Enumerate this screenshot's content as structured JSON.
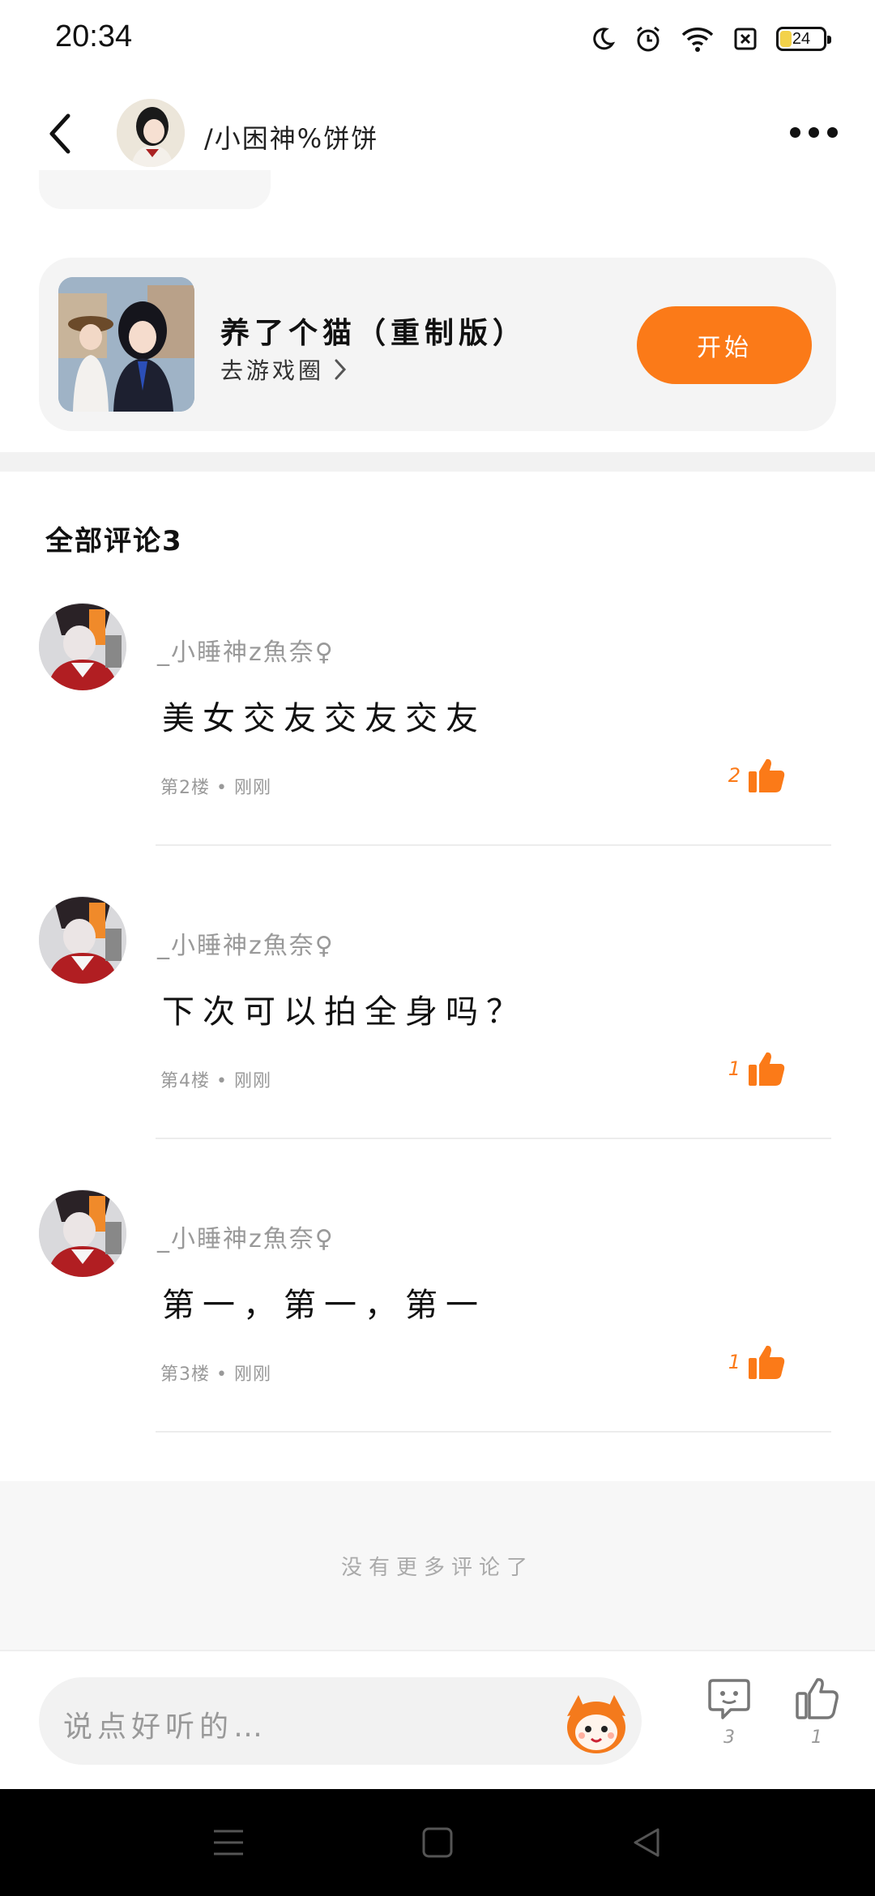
{
  "status_bar": {
    "time": "20:34",
    "battery": "24",
    "icons": [
      "moon-icon",
      "alarm-icon",
      "wifi-icon",
      "sim-off-icon",
      "battery-icon"
    ]
  },
  "header": {
    "user_name": "/小困神%饼饼",
    "back_icon": "back-arrow-icon",
    "more_icon": "more-dots-icon"
  },
  "game_card": {
    "title": "养了个猫（重制版）",
    "subtitle": "去游戏圈",
    "button_label": "开始",
    "accent_color": "#fb7a18"
  },
  "comments_section": {
    "title": "全部评论3",
    "comments": [
      {
        "author": "_小睡神z魚奈♀",
        "text": "美女交友交友交友",
        "meta": "第2楼 • 刚刚",
        "likes": "2"
      },
      {
        "author": "_小睡神z魚奈♀",
        "text": "下次可以拍全身吗？",
        "meta": "第4楼 • 刚刚",
        "likes": "1"
      },
      {
        "author": "_小睡神z魚奈♀",
        "text": "第一，第一，第一",
        "meta": "第3楼 • 刚刚",
        "likes": "1"
      }
    ],
    "no_more": "没有更多评论了"
  },
  "bottom_bar": {
    "input_placeholder": "说点好听的…",
    "comment_count": "3",
    "like_count": "1"
  }
}
